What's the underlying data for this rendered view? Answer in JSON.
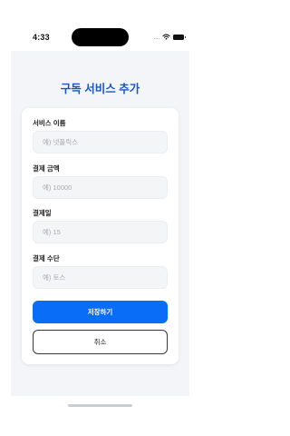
{
  "status_bar": {
    "time": "4:33",
    "signal_dots": "....",
    "icons": [
      "wifi-icon",
      "battery-icon"
    ]
  },
  "page": {
    "title": "구독 서비스 추가"
  },
  "form": {
    "fields": [
      {
        "label": "서비스 이름",
        "value": "",
        "placeholder": "예) 넷플릭스"
      },
      {
        "label": "결제 금액",
        "value": "",
        "placeholder": "예) 10000"
      },
      {
        "label": "결제일",
        "value": "",
        "placeholder": "예) 15"
      },
      {
        "label": "결제 수단",
        "value": "",
        "placeholder": "예) 토스"
      }
    ],
    "save_label": "저장하기",
    "cancel_label": "취소"
  },
  "colors": {
    "accent": "#0a6df7",
    "title": "#1a56c6",
    "background": "#f3f5f8",
    "card": "#ffffff"
  }
}
